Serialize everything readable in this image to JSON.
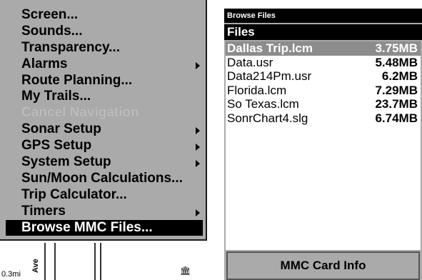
{
  "menu": {
    "items": [
      {
        "label": "Screen...",
        "submenu": false,
        "state": "normal"
      },
      {
        "label": "Sounds...",
        "submenu": false,
        "state": "normal"
      },
      {
        "label": "Transparency...",
        "submenu": false,
        "state": "normal"
      },
      {
        "label": "Alarms",
        "submenu": true,
        "state": "normal"
      },
      {
        "label": "Route Planning...",
        "submenu": false,
        "state": "normal"
      },
      {
        "label": "My Trails...",
        "submenu": false,
        "state": "normal"
      },
      {
        "label": "Cancel Navigation",
        "submenu": false,
        "state": "disabled"
      },
      {
        "label": "Sonar Setup",
        "submenu": true,
        "state": "normal"
      },
      {
        "label": "GPS Setup",
        "submenu": true,
        "state": "normal"
      },
      {
        "label": "System Setup",
        "submenu": true,
        "state": "normal"
      },
      {
        "label": "Sun/Moon Calculations...",
        "submenu": false,
        "state": "normal"
      },
      {
        "label": "Trip Calculator...",
        "submenu": false,
        "state": "normal"
      },
      {
        "label": "Timers",
        "submenu": true,
        "state": "normal"
      },
      {
        "label": "Browse MMC Files...",
        "submenu": false,
        "state": "selected"
      }
    ]
  },
  "map": {
    "scale_label": "0.3mi",
    "road_label": "Ave",
    "poi_icon": "building-icon"
  },
  "browse": {
    "title": "Browse Files",
    "header": "Files",
    "files": [
      {
        "name": "Dallas Trip.lcm",
        "size": "3.75MB",
        "selected": true
      },
      {
        "name": "Data.usr",
        "size": "5.48MB",
        "selected": false
      },
      {
        "name": "Data214Pm.usr",
        "size": "6.2MB",
        "selected": false
      },
      {
        "name": "Florida.lcm",
        "size": "7.29MB",
        "selected": false
      },
      {
        "name": "So Texas.lcm",
        "size": "23.7MB",
        "selected": false
      },
      {
        "name": "SonrChart4.slg",
        "size": "6.74MB",
        "selected": false
      }
    ],
    "card_info_label": "MMC Card Info"
  }
}
